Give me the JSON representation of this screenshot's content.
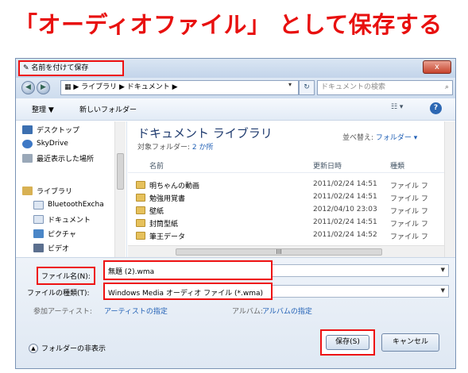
{
  "banner": {
    "text": "「オーディオファイル」 として保存する"
  },
  "window": {
    "title": "名前を付けて保存",
    "close_label": "x"
  },
  "addressbar": {
    "path": "▶ ライブラリ ▶ ドキュメント ▶",
    "search_placeholder": "ドキュメントの検索"
  },
  "toolbar": {
    "organize": "整理 ▼",
    "new_folder": "新しいフォルダー",
    "help": "?"
  },
  "sidebar": {
    "items": [
      {
        "label": "デスクトップ",
        "icon": "desktop-icon"
      },
      {
        "label": "SkyDrive",
        "icon": "cloud-icon"
      },
      {
        "label": "最近表示した場所",
        "icon": "recent-places-icon"
      },
      {
        "label": "ライブラリ",
        "icon": "library-icon"
      },
      {
        "label": "BluetoothExcha",
        "icon": "folder-icon"
      },
      {
        "label": "ドキュメント",
        "icon": "documents-icon"
      },
      {
        "label": "ピクチャ",
        "icon": "pictures-icon"
      },
      {
        "label": "ビデオ",
        "icon": "videos-icon"
      }
    ]
  },
  "main": {
    "library_title": "ドキュメント ライブラリ",
    "library_subtitle": "対象フォルダー:",
    "library_count": "2 か所",
    "sort_label": "並べ替え:",
    "sort_value": "フォルダー ▾",
    "columns": {
      "name": "名前",
      "date": "更新日時",
      "type": "種類"
    },
    "files": [
      {
        "name": "明ちゃんの動画",
        "date": "2011/02/24 14:51",
        "type": "ファイル フ"
      },
      {
        "name": "勉強用覚書",
        "date": "2011/02/24 14:51",
        "type": "ファイル フ"
      },
      {
        "name": "壁紙",
        "date": "2012/04/10 23:03",
        "type": "ファイル フ"
      },
      {
        "name": "封筒型紙",
        "date": "2011/02/24 14:51",
        "type": "ファイル フ"
      },
      {
        "name": "筆王データ",
        "date": "2011/02/24 14:52",
        "type": "ファイル フ"
      }
    ],
    "hscroll_grip": "III"
  },
  "form": {
    "filename_label": "ファイル名(N):",
    "filename_value": "無題 (2).wma",
    "filetype_label": "ファイルの種類(T):",
    "filetype_value": "Windows Media オーディオ ファイル (*.wma)",
    "artist_label": "参加アーティスト:",
    "artist_value": "アーティストの指定",
    "album_label": "アルバム:",
    "album_value": "アルバムの指定",
    "hide_folders": "フォルダーの非表示",
    "save_button": "保存(S)",
    "cancel_button": "キャンセル"
  }
}
